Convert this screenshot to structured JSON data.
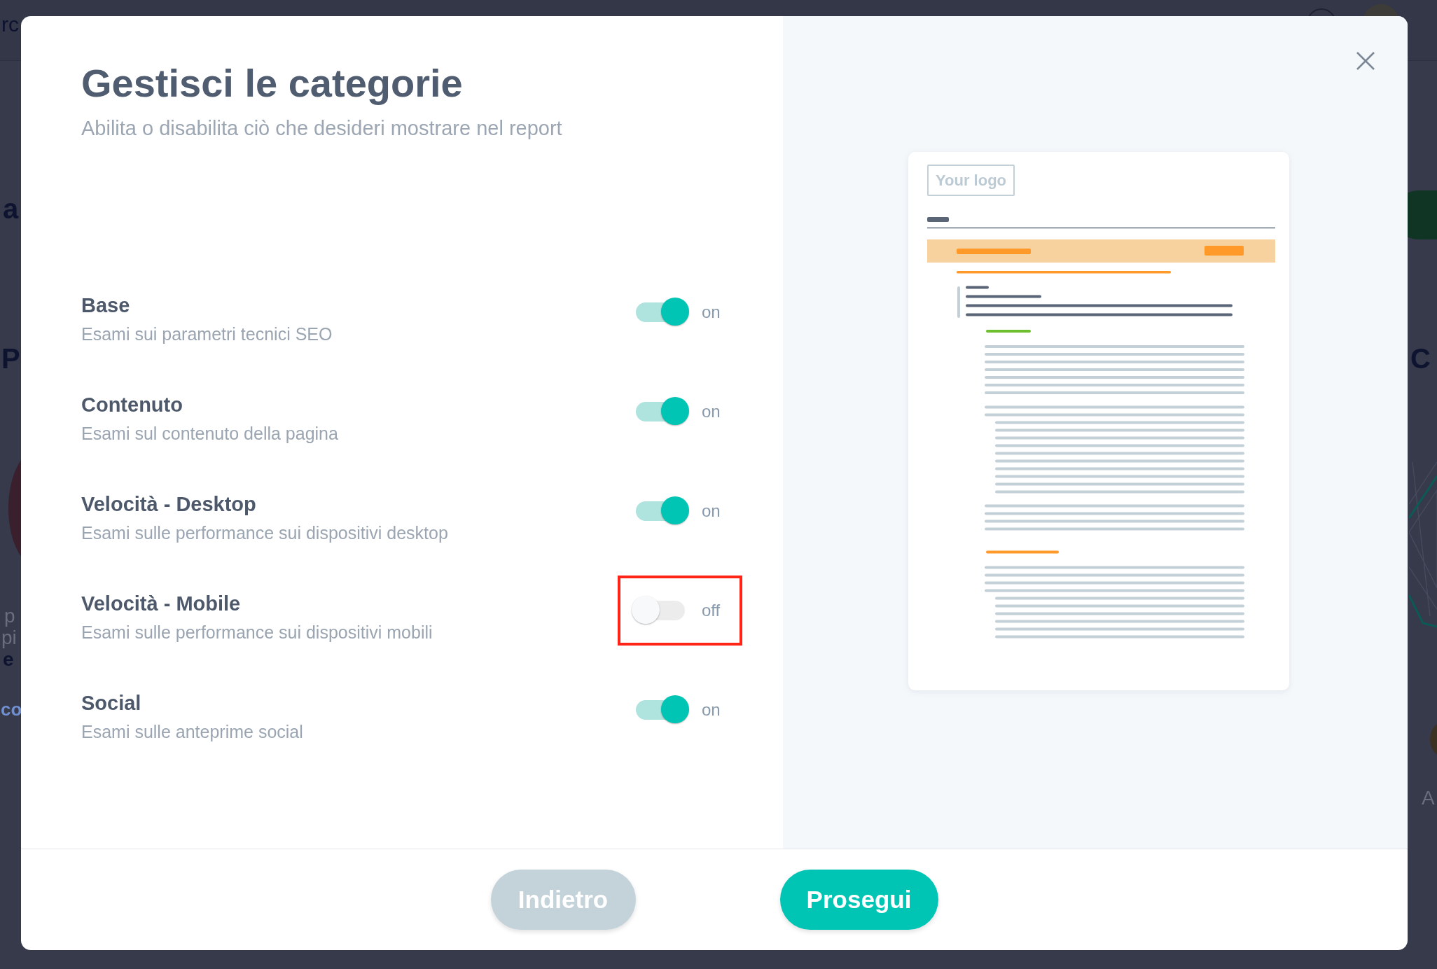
{
  "backdrop": {
    "top_text": "rc",
    "fragments": [
      {
        "text": "a",
        "kind": "heading"
      },
      {
        "text": "P",
        "kind": "heading"
      },
      {
        "text": "p",
        "kind": "body"
      },
      {
        "text": "pi",
        "kind": "body"
      },
      {
        "text": "e",
        "kind": "strong"
      },
      {
        "text": "co",
        "kind": "link"
      },
      {
        "text": "C",
        "kind": "heading"
      },
      {
        "text": "A",
        "kind": "body"
      }
    ]
  },
  "dialog": {
    "title": "Gestisci le categorie",
    "subtitle": "Abilita o disabilita ciò che desideri mostrare nel report",
    "categories": [
      {
        "name": "Base",
        "description": "Esami sui parametri tecnici SEO",
        "on": true,
        "state_label": "on",
        "highlighted": false
      },
      {
        "name": "Contenuto",
        "description": "Esami sul contenuto della pagina",
        "on": true,
        "state_label": "on",
        "highlighted": false
      },
      {
        "name": "Velocità - Desktop",
        "description": "Esami sulle performance sui dispositivi desktop",
        "on": true,
        "state_label": "on",
        "highlighted": false
      },
      {
        "name": "Velocità - Mobile",
        "description": "Esami sulle performance sui dispositivi mobili",
        "on": false,
        "state_label": "off",
        "highlighted": true
      },
      {
        "name": "Social",
        "description": "Esami sulle anteprime social",
        "on": true,
        "state_label": "on",
        "highlighted": false
      }
    ],
    "preview": {
      "logo_placeholder": "Your logo"
    },
    "buttons": [
      {
        "label": "Indietro",
        "kind": "back",
        "disabled": true
      },
      {
        "label": "Prosegui",
        "kind": "next",
        "disabled": false
      }
    ]
  }
}
